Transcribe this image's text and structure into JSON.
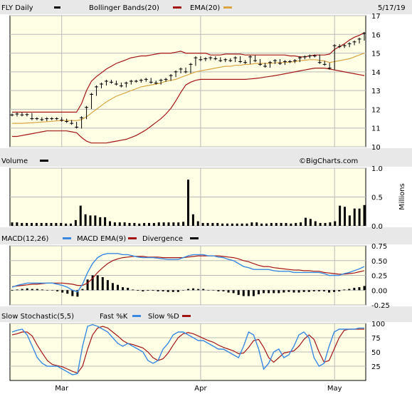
{
  "header": {
    "symbol_label": "FLY Daily",
    "bollinger_label": "Bollinger Bands(20)",
    "ema_label": "EMA(20)",
    "date": "5/17/19",
    "volume_label": "Volume",
    "watermark": "©BigCharts.com",
    "volume_unit": "Millions",
    "macd_label": "MACD(12,26)",
    "macd_ema_label": "MACD EMA(9)",
    "divergence_label": "Divergence",
    "stoch_label": "Slow Stochastic(5,5)",
    "fast_k_label": "Fast %K",
    "slow_d_label": "Slow %D"
  },
  "colors": {
    "price": "#000000",
    "bollinger": "#a31515",
    "ema": "#d9a441",
    "macd": "#3a88e0",
    "macd_ema": "#a31515",
    "fast_k": "#3a88e0",
    "slow_d": "#a31515",
    "legend_black": "#000000",
    "plot_bg": "#ffffe6"
  },
  "chart_data": [
    {
      "type": "line",
      "name": "price",
      "x_tick_labels": [
        "Mar",
        "Apr",
        "May"
      ],
      "x_tick_index": [
        10,
        38,
        65
      ],
      "ylim": [
        10,
        17
      ],
      "yticks": [
        "10",
        "11",
        "12",
        "13",
        "14",
        "15",
        "16",
        "17"
      ],
      "grid": true,
      "series": [
        {
          "name": "FLY Daily",
          "style": "bars",
          "values": [
            11.7,
            11.75,
            11.7,
            11.72,
            11.5,
            11.5,
            11.45,
            11.5,
            11.5,
            11.5,
            11.42,
            11.35,
            11.25,
            11.05,
            11.55,
            12.1,
            12.8,
            13.2,
            13.35,
            13.5,
            13.45,
            13.35,
            13.25,
            13.4,
            13.5,
            13.5,
            13.55,
            13.6,
            13.45,
            13.4,
            13.55,
            13.6,
            13.8,
            14.0,
            14.15,
            14.0,
            14.4,
            14.75,
            14.65,
            14.7,
            14.75,
            14.7,
            14.6,
            14.65,
            14.6,
            14.75,
            14.55,
            14.5,
            14.8,
            14.6,
            14.4,
            14.3,
            14.5,
            14.6,
            14.45,
            14.55,
            14.55,
            14.6,
            14.75,
            14.8,
            14.85,
            14.85,
            14.5,
            14.4,
            14.2,
            15.4,
            15.35,
            15.4,
            15.5,
            15.6,
            15.75,
            16.05
          ]
        },
        {
          "name": "Bollinger Bands(20) Upper",
          "values": [
            11.85,
            11.85,
            11.85,
            11.85,
            11.85,
            11.85,
            11.85,
            11.85,
            11.85,
            11.85,
            11.85,
            11.85,
            11.85,
            11.85,
            12.3,
            13.0,
            13.5,
            13.75,
            13.95,
            14.15,
            14.3,
            14.45,
            14.55,
            14.65,
            14.75,
            14.8,
            14.85,
            14.85,
            14.9,
            14.95,
            15.0,
            15.0,
            15.0,
            15.05,
            15.1,
            15.0,
            15.0,
            15.0,
            15.0,
            15.0,
            14.9,
            14.9,
            14.9,
            14.95,
            14.95,
            14.95,
            14.95,
            14.9,
            14.9,
            14.9,
            14.9,
            14.9,
            14.9,
            14.9,
            14.9,
            14.9,
            14.85,
            14.85,
            14.8,
            14.8,
            14.85,
            14.9,
            14.9,
            14.9,
            14.95,
            15.2,
            15.35,
            15.5,
            15.7,
            15.85,
            15.95,
            16.1
          ]
        },
        {
          "name": "Bollinger Bands(20) Lower",
          "values": [
            10.55,
            10.55,
            10.6,
            10.65,
            10.7,
            10.75,
            10.8,
            10.85,
            10.85,
            10.85,
            10.85,
            10.85,
            10.8,
            10.75,
            10.5,
            10.3,
            10.2,
            10.2,
            10.2,
            10.2,
            10.25,
            10.3,
            10.35,
            10.4,
            10.5,
            10.6,
            10.75,
            10.9,
            11.1,
            11.3,
            11.5,
            11.75,
            12.05,
            12.45,
            12.9,
            13.3,
            13.45,
            13.55,
            13.6,
            13.6,
            13.6,
            13.6,
            13.6,
            13.6,
            13.6,
            13.6,
            13.6,
            13.6,
            13.62,
            13.65,
            13.68,
            13.72,
            13.76,
            13.8,
            13.85,
            13.9,
            13.95,
            14.0,
            14.05,
            14.1,
            14.15,
            14.2,
            14.2,
            14.2,
            14.15,
            14.1,
            14.05,
            14.0,
            13.95,
            13.9,
            13.85,
            13.8
          ]
        },
        {
          "name": "EMA(20)",
          "values": [
            11.25,
            11.25,
            11.25,
            11.27,
            11.28,
            11.3,
            11.32,
            11.34,
            11.36,
            11.38,
            11.4,
            11.4,
            11.4,
            11.4,
            11.45,
            11.6,
            11.8,
            12.0,
            12.2,
            12.4,
            12.55,
            12.7,
            12.8,
            12.9,
            13.0,
            13.1,
            13.2,
            13.25,
            13.3,
            13.35,
            13.4,
            13.5,
            13.55,
            13.6,
            13.7,
            13.8,
            13.9,
            14.0,
            14.05,
            14.1,
            14.15,
            14.2,
            14.25,
            14.3,
            14.3,
            14.35,
            14.35,
            14.4,
            14.4,
            14.45,
            14.45,
            14.45,
            14.45,
            14.48,
            14.5,
            14.5,
            14.52,
            14.55,
            14.6,
            14.62,
            14.65,
            14.65,
            14.62,
            14.58,
            14.5,
            14.55,
            14.6,
            14.65,
            14.7,
            14.8,
            14.9,
            15.0
          ]
        }
      ]
    },
    {
      "type": "bar",
      "name": "Volume",
      "ylim": [
        0,
        1.0
      ],
      "yticks": [
        "0.0",
        "0.5",
        "1.0"
      ],
      "ylabel": "Millions",
      "grid": true,
      "values": [
        0.06,
        0.06,
        0.05,
        0.05,
        0.05,
        0.05,
        0.05,
        0.05,
        0.05,
        0.05,
        0.05,
        0.04,
        0.04,
        0.1,
        0.35,
        0.2,
        0.18,
        0.18,
        0.15,
        0.15,
        0.08,
        0.06,
        0.06,
        0.06,
        0.05,
        0.05,
        0.04,
        0.05,
        0.05,
        0.05,
        0.06,
        0.06,
        0.06,
        0.06,
        0.06,
        0.07,
        0.8,
        0.2,
        0.08,
        0.05,
        0.05,
        0.05,
        0.05,
        0.04,
        0.04,
        0.04,
        0.04,
        0.04,
        0.04,
        0.06,
        0.06,
        0.04,
        0.04,
        0.05,
        0.05,
        0.05,
        0.05,
        0.04,
        0.05,
        0.06,
        0.14,
        0.12,
        0.08,
        0.05,
        0.05,
        0.06,
        0.08,
        0.35,
        0.33,
        0.18,
        0.3,
        0.3,
        0.36
      ]
    },
    {
      "type": "line",
      "name": "MACD",
      "ylim": [
        -0.25,
        0.75
      ],
      "yticks": [
        "-0.25",
        "0.00",
        "0.25",
        "0.50",
        "0.75"
      ],
      "grid": true,
      "series": [
        {
          "name": "MACD(12,26)",
          "values": [
            0.05,
            0.08,
            0.1,
            0.12,
            0.12,
            0.12,
            0.12,
            0.12,
            0.12,
            0.1,
            0.08,
            0.05,
            0.0,
            -0.03,
            0.1,
            0.3,
            0.45,
            0.55,
            0.6,
            0.62,
            0.62,
            0.62,
            0.6,
            0.6,
            0.58,
            0.56,
            0.55,
            0.55,
            0.55,
            0.54,
            0.53,
            0.52,
            0.52,
            0.52,
            0.55,
            0.58,
            0.6,
            0.6,
            0.6,
            0.58,
            0.58,
            0.56,
            0.55,
            0.52,
            0.5,
            0.45,
            0.4,
            0.38,
            0.35,
            0.35,
            0.35,
            0.35,
            0.33,
            0.32,
            0.32,
            0.32,
            0.3,
            0.3,
            0.3,
            0.3,
            0.3,
            0.3,
            0.28,
            0.25,
            0.25,
            0.25,
            0.28,
            0.3,
            0.33,
            0.36,
            0.4
          ]
        },
        {
          "name": "MACD EMA(9)",
          "values": [
            0.06,
            0.07,
            0.08,
            0.09,
            0.1,
            0.1,
            0.11,
            0.12,
            0.12,
            0.12,
            0.12,
            0.11,
            0.1,
            0.08,
            0.08,
            0.12,
            0.2,
            0.3,
            0.38,
            0.45,
            0.5,
            0.53,
            0.55,
            0.56,
            0.57,
            0.57,
            0.57,
            0.56,
            0.56,
            0.56,
            0.55,
            0.55,
            0.55,
            0.55,
            0.55,
            0.56,
            0.57,
            0.58,
            0.58,
            0.58,
            0.58,
            0.58,
            0.57,
            0.56,
            0.55,
            0.53,
            0.5,
            0.48,
            0.45,
            0.42,
            0.4,
            0.4,
            0.38,
            0.37,
            0.36,
            0.35,
            0.34,
            0.34,
            0.33,
            0.33,
            0.32,
            0.32,
            0.3,
            0.29,
            0.28,
            0.27,
            0.27,
            0.28,
            0.29,
            0.31,
            0.33
          ]
        },
        {
          "name": "Divergence",
          "style": "bars",
          "values": [
            -0.01,
            0.01,
            0.02,
            0.03,
            0.02,
            0.02,
            0.01,
            0.0,
            0.0,
            -0.02,
            -0.04,
            -0.06,
            -0.1,
            -0.11,
            0.02,
            0.18,
            0.25,
            0.25,
            0.22,
            0.17,
            0.12,
            0.09,
            0.05,
            0.04,
            0.01,
            -0.01,
            -0.02,
            -0.01,
            -0.01,
            -0.02,
            -0.02,
            -0.03,
            -0.03,
            -0.03,
            0.0,
            0.02,
            0.03,
            0.02,
            0.02,
            0.0,
            0.0,
            -0.02,
            -0.02,
            -0.04,
            -0.05,
            -0.08,
            -0.1,
            -0.1,
            -0.1,
            -0.07,
            -0.05,
            -0.05,
            -0.05,
            -0.05,
            -0.04,
            -0.03,
            -0.04,
            -0.04,
            -0.03,
            -0.03,
            -0.02,
            -0.02,
            -0.02,
            -0.04,
            -0.03,
            -0.02,
            0.01,
            0.02,
            0.04,
            0.05,
            0.07
          ]
        }
      ]
    },
    {
      "type": "line",
      "name": "Slow Stochastic",
      "ylim": [
        0,
        100
      ],
      "yticks": [
        "25",
        "50",
        "75",
        "100"
      ],
      "grid": true,
      "series": [
        {
          "name": "Fast %K",
          "values": [
            85,
            88,
            90,
            80,
            60,
            40,
            30,
            25,
            25,
            25,
            20,
            15,
            10,
            12,
            60,
            95,
            98,
            95,
            90,
            85,
            75,
            65,
            60,
            65,
            60,
            55,
            50,
            35,
            30,
            35,
            55,
            65,
            80,
            85,
            85,
            80,
            75,
            70,
            70,
            65,
            60,
            55,
            55,
            50,
            45,
            40,
            60,
            85,
            80,
            55,
            20,
            30,
            50,
            55,
            40,
            45,
            60,
            80,
            85,
            75,
            40,
            25,
            30,
            60,
            85,
            90,
            90,
            90,
            90,
            92,
            92
          ]
        },
        {
          "name": "Slow %D",
          "values": [
            80,
            82,
            85,
            85,
            78,
            62,
            48,
            35,
            28,
            26,
            24,
            20,
            16,
            13,
            25,
            55,
            80,
            92,
            95,
            92,
            85,
            78,
            70,
            65,
            63,
            60,
            57,
            50,
            40,
            35,
            38,
            48,
            62,
            75,
            82,
            84,
            82,
            78,
            74,
            70,
            67,
            62,
            58,
            55,
            52,
            47,
            48,
            58,
            70,
            72,
            58,
            40,
            32,
            40,
            48,
            50,
            52,
            60,
            72,
            80,
            72,
            50,
            32,
            35,
            55,
            75,
            88,
            90,
            90,
            90,
            90
          ]
        }
      ]
    }
  ]
}
